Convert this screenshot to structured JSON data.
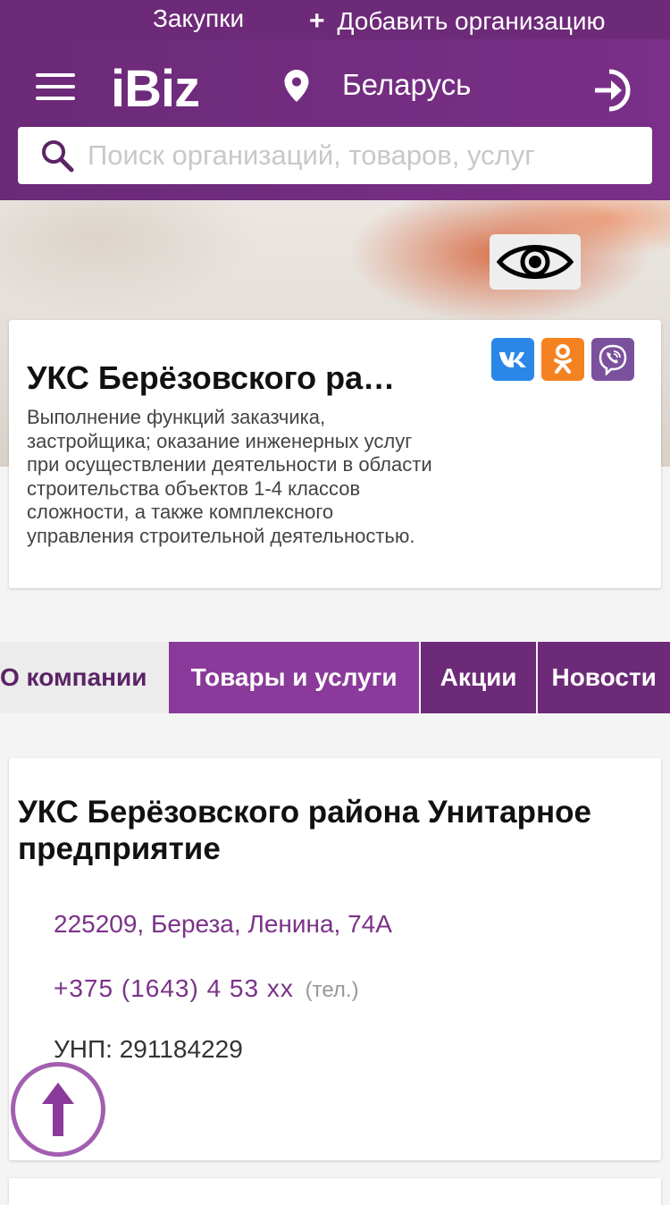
{
  "topbar": {
    "procurement": "Закупки",
    "add_org": "Добавить организацию"
  },
  "header": {
    "logo": "iBiz",
    "region": "Беларусь",
    "search_placeholder": "Поиск организаций, товаров, услуг"
  },
  "company": {
    "short_title": "УКС Берёзовского ра…",
    "description": "Выполнение функций заказчика, застройщика; оказание инженерных услуг при осуществлении деятельности в области строительства объектов 1-4 классов сложности, а также комплексного управления строительной деятельностью."
  },
  "tabs": [
    {
      "label": "О компании"
    },
    {
      "label": "Товары и услуги"
    },
    {
      "label": "Акции"
    },
    {
      "label": "Новости"
    }
  ],
  "info": {
    "full_name": "УКС Берёзовского района Унитарное предприятие",
    "address": "225209, Береза, Ленина, 74А",
    "phone": "+375 (1643) 4 53 xx",
    "phone_note": "(тел.)",
    "unp": "УНП: 291184229"
  },
  "icons": {
    "vk": "vk-icon",
    "ok": "odnoklassniki-icon",
    "viber": "viber-icon",
    "eye": "eye-icon",
    "pin": "location-pin-icon",
    "login": "login-icon",
    "search": "search-icon",
    "menu": "hamburger-menu-icon",
    "up": "arrow-up-icon"
  },
  "colors": {
    "brand": "#6d2a78",
    "active_tab": "#8a3a9a",
    "link": "#7b3289",
    "vk": "#2a87e7",
    "ok": "#f58220",
    "viber": "#7b519d"
  }
}
